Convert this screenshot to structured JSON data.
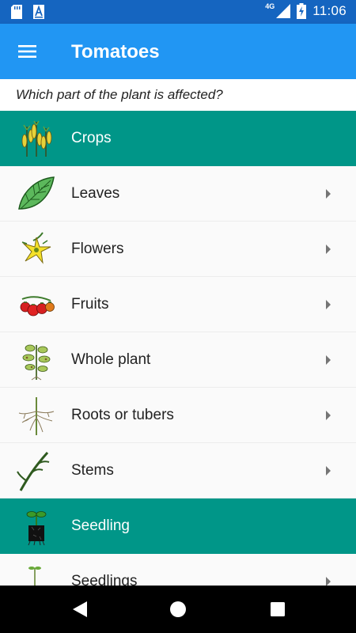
{
  "status_bar": {
    "time": "11:06",
    "network": "4G",
    "icons": [
      "sd-card-icon",
      "a-notification-icon",
      "signal-icon",
      "battery-charging-icon"
    ]
  },
  "app_bar": {
    "title": "Tomatoes",
    "menu_icon": "menu-icon"
  },
  "question": "Which part of the plant is affected?",
  "sections": [
    {
      "header": "Crops",
      "header_icon": "crops-icon",
      "items": [
        {
          "label": "Leaves",
          "icon": "leaf-icon"
        },
        {
          "label": "Flowers",
          "icon": "flower-icon"
        },
        {
          "label": "Fruits",
          "icon": "tomato-fruits-icon"
        },
        {
          "label": "Whole plant",
          "icon": "whole-plant-icon"
        },
        {
          "label": "Roots or tubers",
          "icon": "roots-icon"
        },
        {
          "label": "Stems",
          "icon": "stem-icon"
        }
      ]
    },
    {
      "header": "Seedling",
      "header_icon": "seedling-pot-icon",
      "items": [
        {
          "label": "Seedlings",
          "icon": "seedling-icon"
        }
      ]
    }
  ],
  "nav": {
    "back": "back-icon",
    "home": "home-icon",
    "recents": "recents-icon"
  },
  "colors": {
    "status_bar": "#1565c0",
    "app_bar": "#2196f3",
    "section_header": "#009688",
    "nav_bar": "#000000"
  }
}
